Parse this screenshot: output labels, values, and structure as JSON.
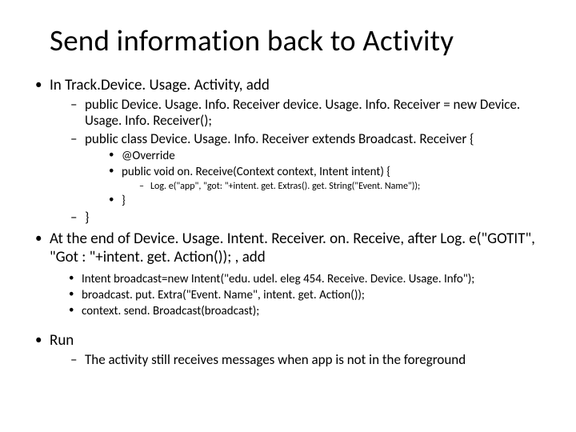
{
  "title": "Send information back to Activity",
  "b1": "In Track.Device. Usage. Activity, add",
  "b1s1": "public Device. Usage. Info. Receiver device. Usage. Info. Receiver = new Device. Usage. Info. Receiver();",
  "b1s2": "public class Device. Usage. Info. Receiver extends Broadcast. Receiver {",
  "b1s2a": "@Override",
  "b1s2b": "public void on. Receive(Context context, Intent intent) {",
  "b1s2b1": "Log. e(\"app\", \"got: \"+intent. get. Extras(). get. String(\"Event. Name\"));",
  "b1s2c": "}",
  "b1s3": "}",
  "b2": "At the end of Device. Usage. Intent. Receiver. on. Receive, after Log. e(\"GOTIT\", \"Got : \"+intent. get. Action()); , add",
  "b2a": "Intent broadcast=new Intent(\"edu. udel. eleg 454. Receive. Device. Usage. Info\");",
  "b2b": "broadcast. put. Extra(\"Event. Name\", intent. get. Action());",
  "b2c": "context. send. Broadcast(broadcast);",
  "b3": "Run",
  "b3a": "The activity still receives messages when app is not in the foreground"
}
